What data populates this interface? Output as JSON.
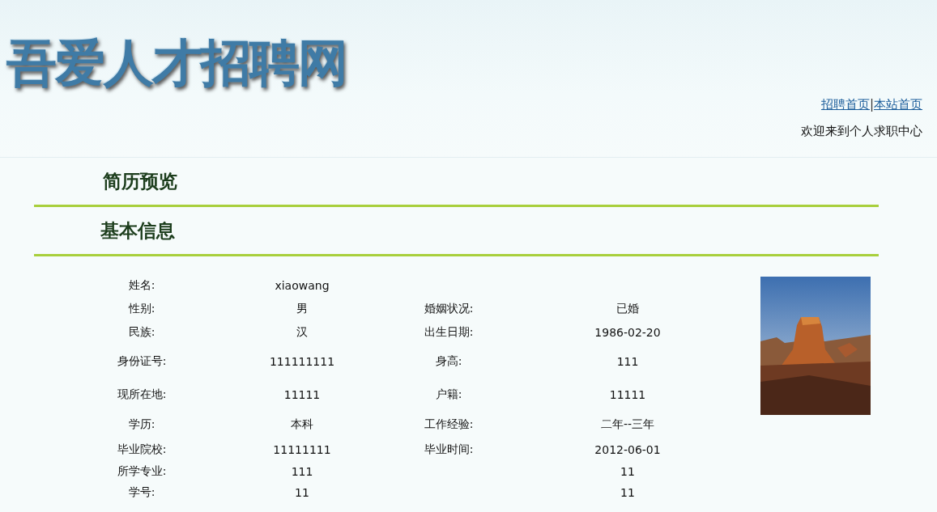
{
  "header": {
    "logo": "吾爱人才招聘网",
    "links": [
      "招聘首页",
      "本站首页"
    ],
    "link_separator": "|",
    "welcome": "欢迎来到个人求职中心"
  },
  "page_title": "简历预览",
  "section_title": "基本信息",
  "rows": [
    {
      "label_1": "姓名:",
      "value_1": "xiaowang",
      "label_2": "",
      "value_2": ""
    },
    {
      "label_1": "性别:",
      "value_1": "男",
      "label_2": "婚姻状况:",
      "value_2": "已婚"
    },
    {
      "label_1": "民族:",
      "value_1": "汉",
      "label_2": "出生日期:",
      "value_2": "1986-02-20"
    },
    {
      "label_1": "身份证号:",
      "value_1": "111111111",
      "label_2": "身高:",
      "value_2": "111"
    },
    {
      "label_1": "现所在地:",
      "value_1": "11111",
      "label_2": "户籍:",
      "value_2": "11111"
    },
    {
      "label_1": "学历:",
      "value_1": "本科",
      "label_2": "工作经验:",
      "value_2": "二年--三年"
    },
    {
      "label_1": "毕业院校:",
      "value_1": "11111111",
      "label_2": "毕业时间:",
      "value_2": "2012-06-01"
    },
    {
      "label_1": "所学专业:",
      "value_1": "111",
      "label_2": "",
      "value_2": "11"
    },
    {
      "label_1": "学号:",
      "value_1": "11",
      "label_2": "",
      "value_2": "11"
    }
  ]
}
